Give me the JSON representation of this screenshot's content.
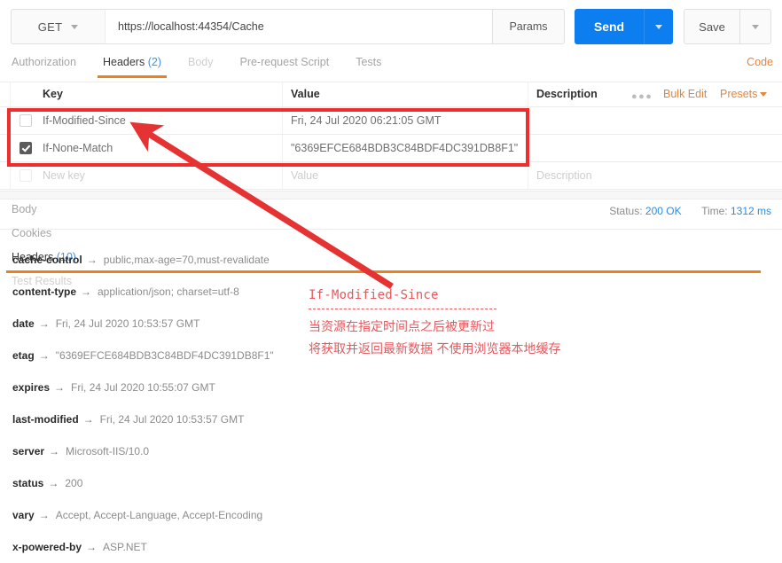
{
  "request_bar": {
    "method": "GET",
    "method_caret_icon": "chevron-down-icon",
    "url": "https://localhost:44354/Cache",
    "url_placeholder": "Enter request URL",
    "params_label": "Params",
    "send_label": "Send",
    "send_caret_icon": "chevron-down-icon",
    "save_label": "Save",
    "save_caret_icon": "chevron-down-icon"
  },
  "request_tabs": {
    "items": [
      {
        "label": "Authorization",
        "state": "normal"
      },
      {
        "label": "Headers",
        "count": "(2)",
        "state": "active"
      },
      {
        "label": "Body",
        "state": "dim"
      },
      {
        "label": "Pre-request Script",
        "state": "normal"
      },
      {
        "label": "Tests",
        "state": "normal"
      }
    ],
    "code_link": "Code"
  },
  "headers_table": {
    "columns": {
      "key": "Key",
      "value": "Value",
      "description": "Description"
    },
    "dots_icon": "ellipsis-icon",
    "bulk_edit": "Bulk Edit",
    "presets": "Presets",
    "presets_caret_icon": "chevron-down-icon",
    "rows": [
      {
        "checked": false,
        "key": "If-Modified-Since",
        "value": "Fri, 24 Jul 2020 06:21:05 GMT",
        "description": ""
      },
      {
        "checked": true,
        "key": "If-None-Match",
        "value": "\"6369EFCE684BDB3C84BDF4DC391DB8F1\"",
        "description": ""
      }
    ],
    "new_row": {
      "key_placeholder": "New key",
      "value_placeholder": "Value",
      "description_placeholder": "Description"
    }
  },
  "response_tabs": {
    "items": [
      {
        "label": "Body",
        "state": "normal"
      },
      {
        "label": "Cookies",
        "state": "normal"
      },
      {
        "label": "Headers",
        "count": "(10)",
        "state": "active"
      },
      {
        "label": "Test Results",
        "state": "dim"
      }
    ],
    "status_label": "Status:",
    "status_value": "200 OK",
    "time_label": "Time:",
    "time_value": "1312 ms"
  },
  "response_headers": {
    "arrow_glyph": "→",
    "items": [
      {
        "name": "cache-control",
        "value": "public,max-age=70,must-revalidate"
      },
      {
        "name": "content-type",
        "value": "application/json; charset=utf-8"
      },
      {
        "name": "date",
        "value": "Fri, 24 Jul 2020 10:53:57 GMT"
      },
      {
        "name": "etag",
        "value": "\"6369EFCE684BDB3C84BDF4DC391DB8F1\""
      },
      {
        "name": "expires",
        "value": "Fri, 24 Jul 2020 10:55:07 GMT"
      },
      {
        "name": "last-modified",
        "value": "Fri, 24 Jul 2020 10:53:57 GMT"
      },
      {
        "name": "server",
        "value": "Microsoft-IIS/10.0"
      },
      {
        "name": "status",
        "value": "200"
      },
      {
        "name": "vary",
        "value": "Accept, Accept-Language, Accept-Encoding"
      },
      {
        "name": "x-powered-by",
        "value": "ASP.NET"
      }
    ]
  },
  "annotation": {
    "title": "If-Modified-Since",
    "line1": "当资源在指定时间点之后被更新过",
    "line2": "将获取并返回最新数据 不使用浏览器本地缓存",
    "color": "#e8575c",
    "box_color": "#ef2d2d"
  }
}
